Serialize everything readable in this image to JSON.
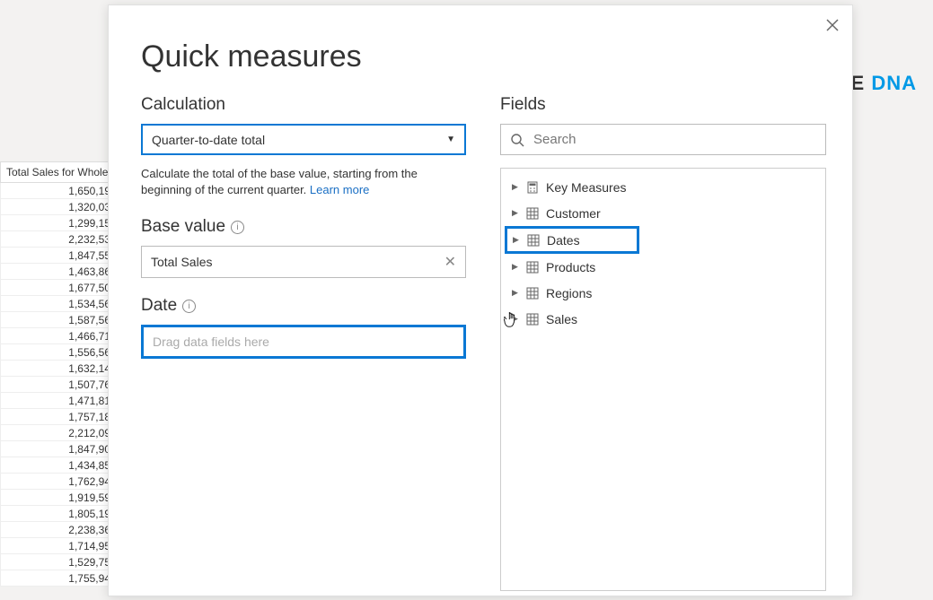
{
  "brand": {
    "se": "SE",
    "dna": " DNA"
  },
  "bg_table": {
    "header": "Total Sales for Whole",
    "rows": [
      "1,650,19",
      "1,320,03",
      "1,299,15",
      "2,232,53",
      "1,847,55",
      "1,463,86",
      "1,677,50",
      "1,534,56",
      "1,587,56",
      "1,466,71",
      "1,556,56",
      "1,632,14",
      "1,507,76",
      "1,471,81",
      "1,757,18",
      "2,212,09",
      "1,847,90",
      "1,434,85",
      "1,762,94",
      "1,919,59",
      "1,805,19",
      "2,238,36",
      "1,714,95",
      "1,529,75",
      "1,755,94"
    ]
  },
  "dialog": {
    "title": "Quick measures",
    "close_tooltip": "Close"
  },
  "calc": {
    "label": "Calculation",
    "selected": "Quarter-to-date total",
    "help": "Calculate the total of the base value, starting from the beginning of the current quarter.  ",
    "learn_more": "Learn more"
  },
  "base_value": {
    "label": "Base value",
    "chip": "Total Sales"
  },
  "date": {
    "label": "Date",
    "placeholder": "Drag data fields here"
  },
  "fields": {
    "label": "Fields",
    "search_placeholder": "Search",
    "items": [
      {
        "name": "Key Measures",
        "icon": "calc",
        "highlight": false
      },
      {
        "name": "Customer",
        "icon": "table",
        "highlight": false
      },
      {
        "name": "Dates",
        "icon": "table",
        "highlight": true
      },
      {
        "name": "Products",
        "icon": "table",
        "highlight": false
      },
      {
        "name": "Regions",
        "icon": "table",
        "highlight": false
      },
      {
        "name": "Sales",
        "icon": "table",
        "highlight": false
      }
    ]
  }
}
